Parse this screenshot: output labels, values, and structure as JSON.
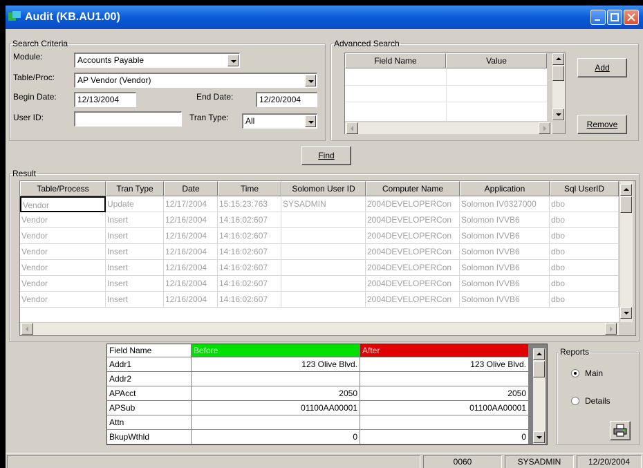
{
  "window": {
    "title": "Audit (KB.AU1.00)"
  },
  "search": {
    "legend": "Search Criteria",
    "module_label": "Module:",
    "module_value": "Accounts Payable",
    "table_label": "Table/Proc:",
    "table_value": "AP  Vendor (Vendor)",
    "begin_label": "Begin Date:",
    "begin_value": "12/13/2004",
    "end_label": "End Date:",
    "end_value": "12/20/2004",
    "user_label": "User ID:",
    "user_value": "",
    "tran_label": "Tran Type:",
    "tran_value": "All"
  },
  "advanced": {
    "legend": "Advanced Search",
    "col_field": "Field Name",
    "col_value": "Value",
    "add_label": "Add",
    "remove_label": "Remove"
  },
  "find_label": "Find",
  "result": {
    "legend": "Result",
    "columns": [
      "Table/Process",
      "Tran Type",
      "Date",
      "Time",
      "Solomon User ID",
      "Computer Name",
      "Application",
      "Sql UserID"
    ],
    "rows": [
      [
        "Vendor",
        "Update",
        "12/17/2004",
        "15:15:23:763",
        "SYSADMIN",
        "2004DEVELOPERCon",
        "Solomon IV0327000",
        "dbo"
      ],
      [
        "Vendor",
        "Insert",
        "12/16/2004",
        "14:16:02:607",
        "",
        "2004DEVELOPERCon",
        "Solomon IVVB6",
        "dbo"
      ],
      [
        "Vendor",
        "Insert",
        "12/16/2004",
        "14:16:02:607",
        "",
        "2004DEVELOPERCon",
        "Solomon IVVB6",
        "dbo"
      ],
      [
        "Vendor",
        "Insert",
        "12/16/2004",
        "14:16:02:607",
        "",
        "2004DEVELOPERCon",
        "Solomon IVVB6",
        "dbo"
      ],
      [
        "Vendor",
        "Insert",
        "12/16/2004",
        "14:16:02:607",
        "",
        "2004DEVELOPERCon",
        "Solomon IVVB6",
        "dbo"
      ],
      [
        "Vendor",
        "Insert",
        "12/16/2004",
        "14:16:02:607",
        "",
        "2004DEVELOPERCon",
        "Solomon IVVB6",
        "dbo"
      ],
      [
        "Vendor",
        "Insert",
        "12/16/2004",
        "14:16:02:607",
        "",
        "2004DEVELOPERCon",
        "Solomon IVVB6",
        "dbo"
      ]
    ]
  },
  "detail": {
    "col_field": "Field Name",
    "col_before": "Before",
    "col_after": "After",
    "before_color": "#00e000",
    "after_color": "#e00000",
    "rows": [
      [
        "Addr1",
        "123 Olive Blvd.",
        "123 Olive Blvd."
      ],
      [
        "Addr2",
        "",
        ""
      ],
      [
        "APAcct",
        "2050",
        "2050"
      ],
      [
        "APSub",
        "01100AA00001",
        "01100AA00001"
      ],
      [
        "Attn",
        "",
        ""
      ],
      [
        "BkupWthld",
        "0",
        "0"
      ]
    ]
  },
  "reports": {
    "legend": "Reports",
    "main_label": "Main",
    "details_label": "Details"
  },
  "status": {
    "company": "0060",
    "user": "SYSADMIN",
    "date": "12/20/2004"
  }
}
